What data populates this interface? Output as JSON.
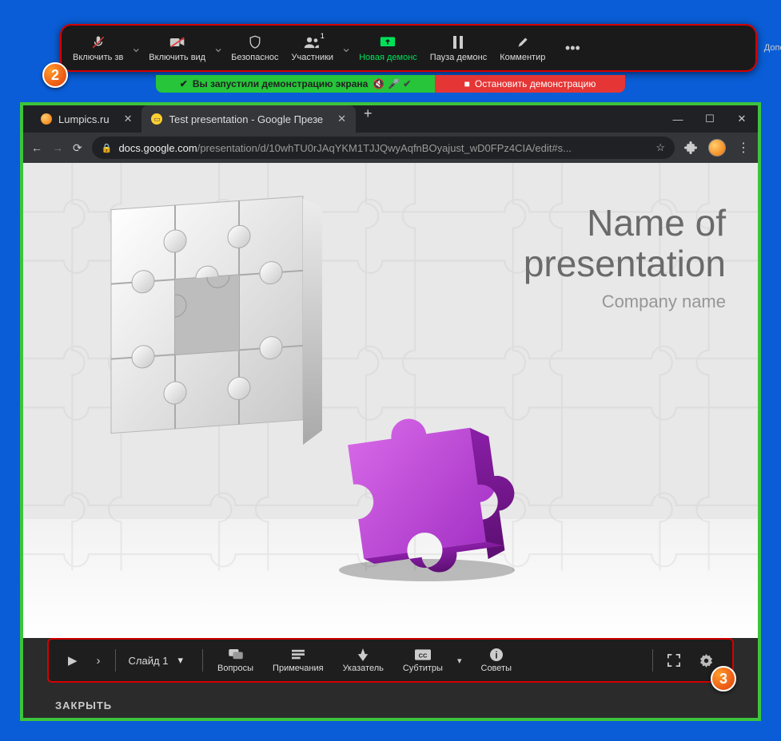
{
  "zoom": {
    "audio": "Включить зв",
    "video": "Включить вид",
    "security": "Безопаснос",
    "participants": "Участники",
    "participants_count": "1",
    "new_share": "Новая демонс",
    "pause_share": "Пауза демонс",
    "annotate": "Комментир",
    "more": "Дополнит"
  },
  "share": {
    "green": "Вы запустили демонстрацию экрана",
    "red": "Остановить демонстрацию"
  },
  "browser": {
    "tab1": "Lumpics.ru",
    "tab2": "Test presentation - Google Презе",
    "url_host": "docs.google.com",
    "url_path": "/presentation/d/10whTU0rJAqYKM1TJJQwyAqfnBOyajust_wD0FPz4CIA/edit#s..."
  },
  "slide": {
    "title_l1": "Name of",
    "title_l2": "presentation",
    "subtitle": "Company name"
  },
  "ptb": {
    "slide": "Слайд 1",
    "questions": "Вопросы",
    "notes": "Примечания",
    "pointer": "Указатель",
    "captions": "Субтитры",
    "tips": "Советы",
    "close": "ЗАКРЫТЬ"
  },
  "badges": {
    "b2": "2",
    "b3": "3"
  }
}
